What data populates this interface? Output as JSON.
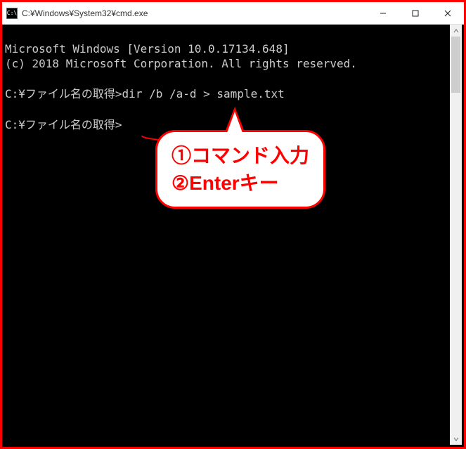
{
  "window": {
    "title": "C:¥Windows¥System32¥cmd.exe"
  },
  "terminal": {
    "line1": "Microsoft Windows [Version 10.0.17134.648]",
    "line2": "(c) 2018 Microsoft Corporation. All rights reserved.",
    "blank1": "",
    "prompt1_prefix": "C:¥ファイル名の取得>",
    "prompt1_cmd": "dir /b /a-d > sample.txt",
    "blank2": "",
    "prompt2_prefix": "C:¥ファイル名の取得>",
    "prompt2_cmd": ""
  },
  "annotation": {
    "callout_line1": "①コマンド入力",
    "callout_line2": "②Enterキー"
  },
  "colors": {
    "accent": "#ff0000",
    "terminal_bg": "#000000",
    "terminal_fg": "#cccccc"
  }
}
